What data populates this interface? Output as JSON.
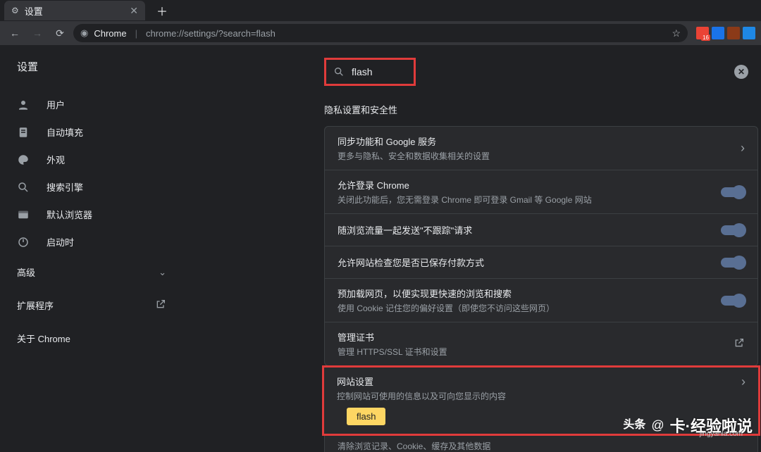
{
  "tab": {
    "title": "设置"
  },
  "omnibox": {
    "scheme": "Chrome",
    "url": "chrome://settings/?search=flash"
  },
  "ext_badge": "16",
  "page_title": "设置",
  "sidebar": {
    "items": [
      {
        "label": "用户"
      },
      {
        "label": "自动填充"
      },
      {
        "label": "外观"
      },
      {
        "label": "搜索引擎"
      },
      {
        "label": "默认浏览器"
      },
      {
        "label": "启动时"
      }
    ],
    "advanced": "高级",
    "extensions": "扩展程序",
    "about": "关于 Chrome"
  },
  "search": {
    "query": "flash"
  },
  "section": {
    "title": "隐私设置和安全性"
  },
  "rows": {
    "sync": {
      "title": "同步功能和 Google 服务",
      "sub": "更多与隐私、安全和数据收集相关的设置"
    },
    "signin": {
      "title": "允许登录 Chrome",
      "sub": "关闭此功能后，您无需登录 Chrome 即可登录 Gmail 等 Google 网站"
    },
    "dnt": {
      "title": "随浏览流量一起发送\"不跟踪\"请求"
    },
    "payment": {
      "title": "允许网站检查您是否已保存付款方式"
    },
    "preload": {
      "title": "预加载网页，以便实现更快速的浏览和搜索",
      "sub": "使用 Cookie 记住您的偏好设置（即使您不访问这些网页）"
    },
    "certs": {
      "title": "管理证书",
      "sub": "管理 HTTPS/SSL 证书和设置"
    },
    "site": {
      "title": "网站设置",
      "sub": "控制网站可使用的信息以及可向您显示的内容"
    },
    "clear": {
      "sub": "清除浏览记录、Cookie、缓存及其他数据"
    }
  },
  "chip": "flash",
  "watermark": {
    "brand1": "头条",
    "brand2": "卡·经验啦说",
    "url": "jingyanla.com"
  }
}
